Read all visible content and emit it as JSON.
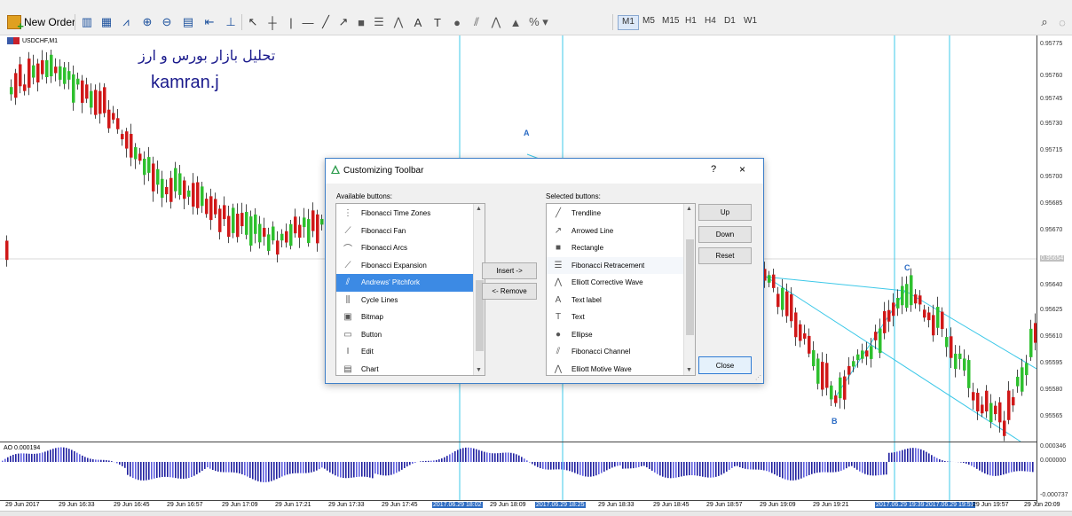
{
  "toolbar": {
    "new_order_label": "New Order",
    "timeframes": [
      "M1",
      "M5",
      "M15",
      "H1",
      "H4",
      "D1",
      "W1"
    ],
    "active_timeframe": "M1"
  },
  "chart": {
    "symbol": "USDCHF,M1",
    "watermark_farsi": "تحلیل بازار بورس و ارز",
    "watermark_name": "kamran.j",
    "points": [
      "A",
      "B",
      "C"
    ],
    "bull_color": "#2ec02e",
    "bear_color": "#d01818",
    "line_color": "#3cc8e8",
    "price_scale": [
      "0.95775",
      "0.95760",
      "0.95745",
      "0.95730",
      "0.95715",
      "0.95700",
      "0.95685",
      "0.95670",
      "0.95654",
      "0.95640",
      "0.95625",
      "0.95610",
      "0.95595",
      "0.95580",
      "0.95565"
    ],
    "current_price": "0.95654"
  },
  "indicator": {
    "label": "AO 0.000194",
    "scale": [
      "0.000346",
      "0.000000",
      "-0.000737"
    ]
  },
  "time_axis": [
    "29 Jun 2017",
    "29 Jun 16:33",
    "29 Jun 16:45",
    "29 Jun 16:57",
    "29 Jun 17:09",
    "29 Jun 17:21",
    "29 Jun 17:33",
    "29 Jun 17:45",
    "2017.06.29 18:02",
    "29 Jun 18:09",
    "2017.06.29 18:25",
    "29 Jun 18:33",
    "29 Jun 18:45",
    "29 Jun 18:57",
    "29 Jun 19:09",
    "29 Jun 19:21",
    "2017.06.29 19:39",
    "2017.06.29 19:51",
    "29 Jun 19:57",
    "29 Jun 20:09"
  ],
  "dialog": {
    "title": "Customizing Toolbar",
    "help": "?",
    "close_x": "×",
    "available_label": "Available buttons:",
    "selected_label": "Selected buttons:",
    "available": [
      {
        "label": "Fibonacci Time Zones",
        "icon": "fibonacci-time-zones-icon"
      },
      {
        "label": "Fibonacci Fan",
        "icon": "fibonacci-fan-icon"
      },
      {
        "label": "Fibonacci Arcs",
        "icon": "fibonacci-arcs-icon"
      },
      {
        "label": "Fibonacci Expansion",
        "icon": "fibonacci-expansion-icon"
      },
      {
        "label": "Andrews' Pitchfork",
        "icon": "pitchfork-icon"
      },
      {
        "label": "Cycle Lines",
        "icon": "cycle-lines-icon"
      },
      {
        "label": "Bitmap",
        "icon": "bitmap-icon"
      },
      {
        "label": "Button",
        "icon": "button-icon"
      },
      {
        "label": "Edit",
        "icon": "edit-icon"
      },
      {
        "label": "Chart",
        "icon": "chart-icon"
      }
    ],
    "available_selected_index": 4,
    "selected": [
      {
        "label": "Trendline",
        "icon": "trendline-icon"
      },
      {
        "label": "Arrowed Line",
        "icon": "arrowed-line-icon"
      },
      {
        "label": "Rectangle",
        "icon": "rectangle-icon"
      },
      {
        "label": "Fibonacci Retracement",
        "icon": "fibonacci-retracement-icon"
      },
      {
        "label": "Elliott Corrective Wave",
        "icon": "elliott-corrective-wave-icon"
      },
      {
        "label": "Text label",
        "icon": "text-label-icon"
      },
      {
        "label": "Text",
        "icon": "text-icon"
      },
      {
        "label": "Ellipse",
        "icon": "ellipse-icon"
      },
      {
        "label": "Fibonacci Channel",
        "icon": "fibonacci-channel-icon"
      },
      {
        "label": "Elliott Motive Wave",
        "icon": "elliott-motive-wave-icon"
      }
    ],
    "selected_hover_index": 3,
    "insert_label": "Insert ->",
    "remove_label": "<- Remove",
    "up_label": "Up",
    "down_label": "Down",
    "reset_label": "Reset",
    "close_label": "Close"
  }
}
